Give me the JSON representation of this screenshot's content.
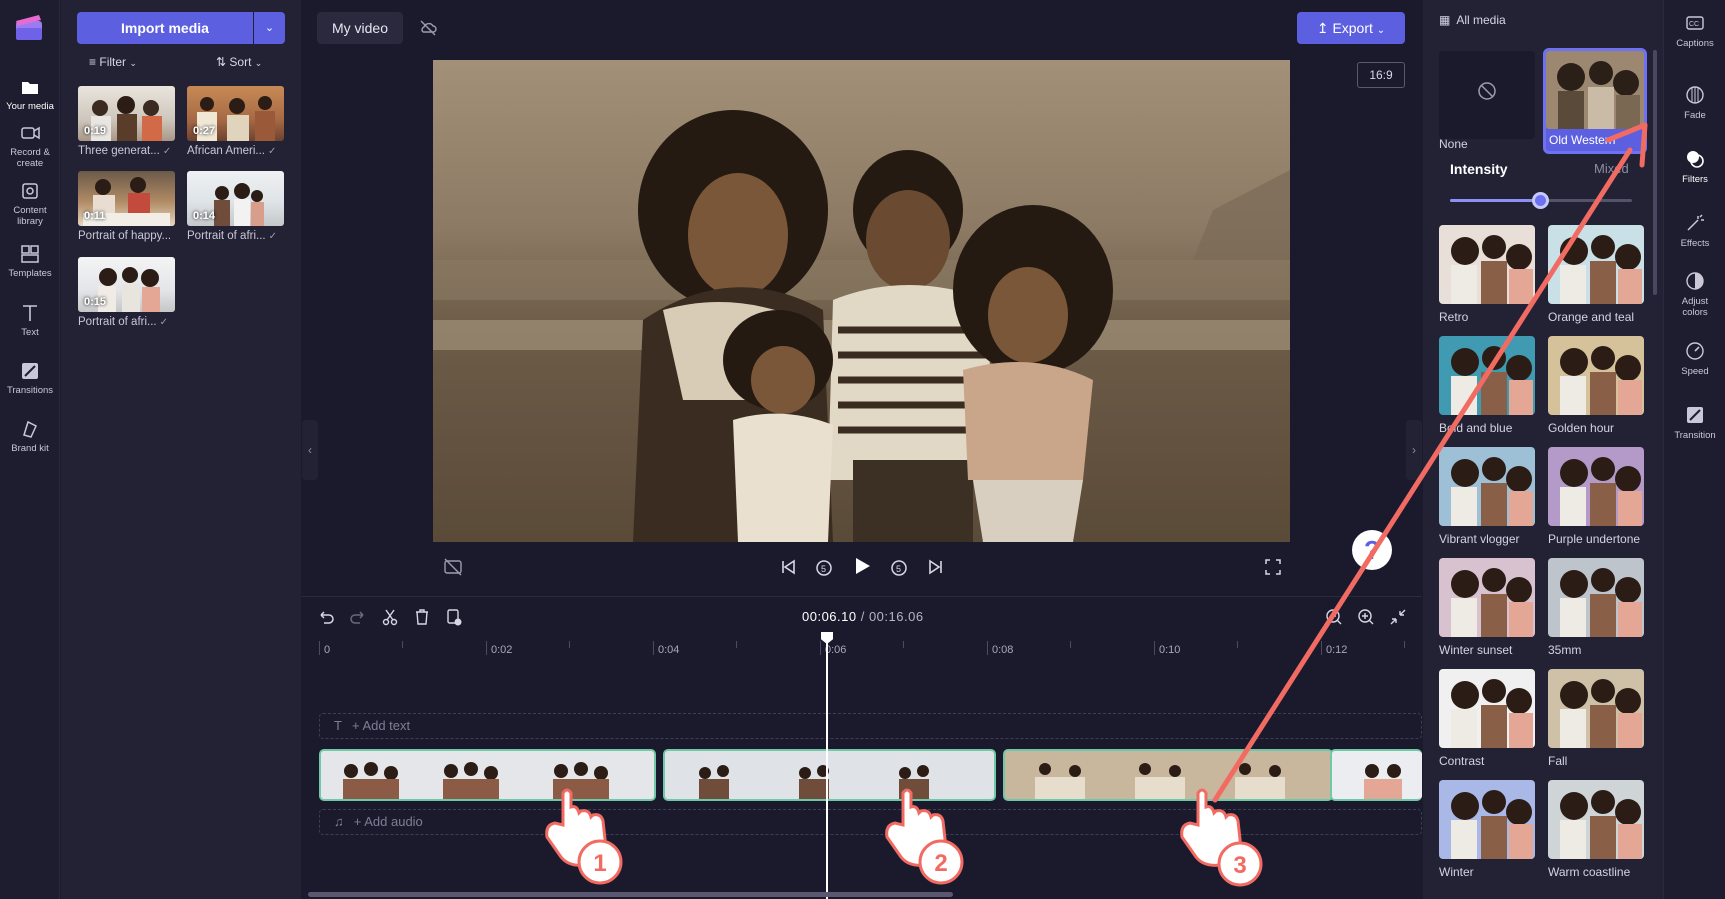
{
  "rail": {
    "items": [
      {
        "label": "Your media",
        "icon": "folder-icon"
      },
      {
        "label": "Record & create",
        "icon": "camera-icon"
      },
      {
        "label": "Content library",
        "icon": "library-icon"
      },
      {
        "label": "Templates",
        "icon": "templates-icon"
      },
      {
        "label": "Text",
        "icon": "text-icon"
      },
      {
        "label": "Transitions",
        "icon": "transitions-icon"
      },
      {
        "label": "Brand kit",
        "icon": "brand-kit-icon"
      }
    ]
  },
  "media": {
    "import_label": "Import media",
    "filter_label": "Filter",
    "sort_label": "Sort",
    "items": [
      {
        "duration": "0:19",
        "label": "Three generat..."
      },
      {
        "duration": "0:27",
        "label": "African Ameri..."
      },
      {
        "duration": "0:11",
        "label": "Portrait of happy..."
      },
      {
        "duration": "0:14",
        "label": "Portrait of afri..."
      },
      {
        "duration": "0:15",
        "label": "Portrait of afri..."
      }
    ]
  },
  "topbar": {
    "project_title": "My video",
    "export_label": "Export",
    "aspect_ratio": "16:9"
  },
  "player": {
    "current_time": "00:06.10",
    "separator": " / ",
    "total_time": "00:16.06",
    "help_label": "?"
  },
  "timeline": {
    "ruler": [
      "0",
      "0:02",
      "0:04",
      "0:06",
      "0:08",
      "0:10",
      "0:12"
    ],
    "add_text": "+ Add text",
    "add_audio": "+ Add audio"
  },
  "filters_panel": {
    "header": "All media",
    "none_label": "None",
    "selected_label": "Old Western",
    "intensity_label": "Intensity",
    "mixed_label": "Mixed",
    "intensity_value": 0.5,
    "filters": [
      {
        "label": "Retro",
        "tint": "#e8e0d8"
      },
      {
        "label": "Orange and teal",
        "tint": "#c9e0e6"
      },
      {
        "label": "Bold and blue",
        "tint": "#3f9ab2"
      },
      {
        "label": "Golden hour",
        "tint": "#d6c29a"
      },
      {
        "label": "Vibrant vlogger",
        "tint": "#9ec0d6"
      },
      {
        "label": "Purple undertone",
        "tint": "#b49ac9"
      },
      {
        "label": "Winter sunset",
        "tint": "#d8c2d0"
      },
      {
        "label": "35mm",
        "tint": "#bec4cc"
      },
      {
        "label": "Contrast",
        "tint": "#f0f0f0"
      },
      {
        "label": "Fall",
        "tint": "#cfc0a8"
      },
      {
        "label": "Winter",
        "tint": "#a9b8e6"
      },
      {
        "label": "Warm coastline",
        "tint": "#cfd4d6"
      }
    ]
  },
  "right_rail": {
    "items": [
      {
        "label": "Captions",
        "icon": "captions-icon"
      },
      {
        "label": "Fade",
        "icon": "fade-icon"
      },
      {
        "label": "Filters",
        "icon": "filters-icon"
      },
      {
        "label": "Effects",
        "icon": "effects-icon"
      },
      {
        "label": "Adjust colors",
        "icon": "adjust-colors-icon"
      },
      {
        "label": "Speed",
        "icon": "speed-icon"
      },
      {
        "label": "Transition",
        "icon": "transition-icon"
      }
    ]
  },
  "annotations": {
    "step1": "1",
    "step2": "2",
    "step3": "3"
  },
  "colors": {
    "accent": "#5b5fe0",
    "clip_border": "#6fc9a6",
    "annotation": "#f26b63"
  }
}
